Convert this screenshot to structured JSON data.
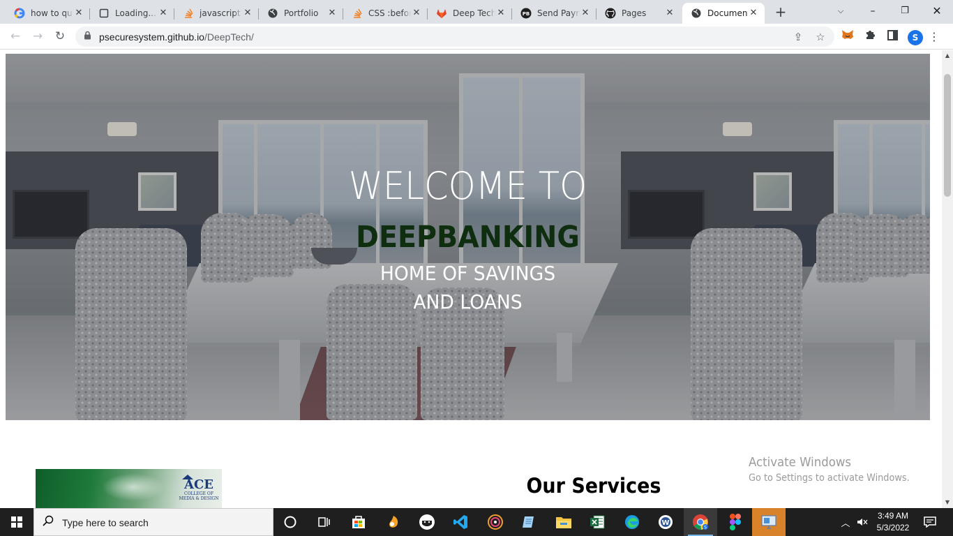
{
  "browser": {
    "tabs": [
      {
        "title": "how to qu",
        "icon": "google-icon",
        "active": false
      },
      {
        "title": "Loading...",
        "icon": "page-icon",
        "active": false
      },
      {
        "title": "javascript -",
        "icon": "stackoverflow-icon",
        "active": false
      },
      {
        "title": "Portfolio",
        "icon": "globe-icon",
        "active": false
      },
      {
        "title": "CSS :befor",
        "icon": "stackoverflow-icon",
        "active": false
      },
      {
        "title": "Deep Tech",
        "icon": "gitlab-icon",
        "active": false
      },
      {
        "title": "Send Paym",
        "icon": "paybill-icon",
        "active": false
      },
      {
        "title": "Pages",
        "icon": "github-icon",
        "active": false
      },
      {
        "title": "Document",
        "icon": "globe-icon",
        "active": true
      }
    ],
    "url_host": "psecuresystem.github.io",
    "url_path": "/DeepTech/",
    "profile_initial": "S"
  },
  "page": {
    "hero": {
      "welcome": "WELCOME TO",
      "brand": "DEEPBANKING",
      "subtitle_line1": "HOME OF SAVINGS",
      "subtitle_line2": "AND LOANS",
      "brand_color": "#0f2e0f"
    },
    "ad_banner": {
      "logo_text": "ACE",
      "logo_subtext": "COLLEGE OF MEDIA & DESIGN"
    },
    "services_heading": "Our Services"
  },
  "watermark": {
    "line1": "Activate Windows",
    "line2": "Go to Settings to activate Windows."
  },
  "taskbar": {
    "search_placeholder": "Type here to search",
    "time": "3:49 AM",
    "date": "5/3/2022",
    "apps": [
      "cortana-icon",
      "task-view-icon",
      "store-icon",
      "fl-studio-icon",
      "game-icon",
      "vscode-icon",
      "media-player-icon",
      "notepad-icon",
      "file-explorer-icon",
      "excel-icon",
      "edge-icon",
      "word-icon",
      "chrome-icon",
      "figma-icon",
      "remote-desktop-icon"
    ]
  }
}
